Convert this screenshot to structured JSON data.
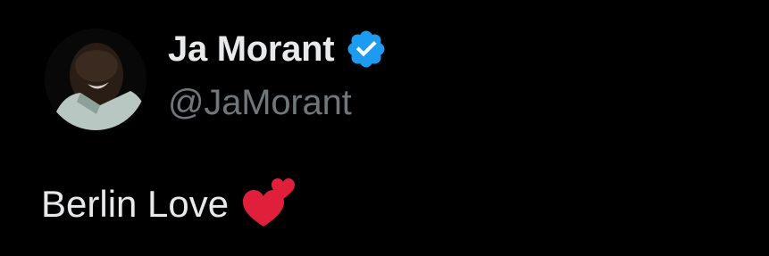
{
  "tweet": {
    "author": {
      "display_name": "Ja Morant",
      "handle": "@JaMorant",
      "verified": true,
      "verified_icon": "verified-badge-icon",
      "avatar": "profile-avatar"
    },
    "text": "Berlin Love",
    "emoji": "two-hearts-icon"
  },
  "colors": {
    "background": "#000000",
    "primary_text": "#e7e9ea",
    "secondary_text": "#71767b",
    "verified_blue": "#1d9bf0",
    "heart_red": "#e0203a"
  }
}
